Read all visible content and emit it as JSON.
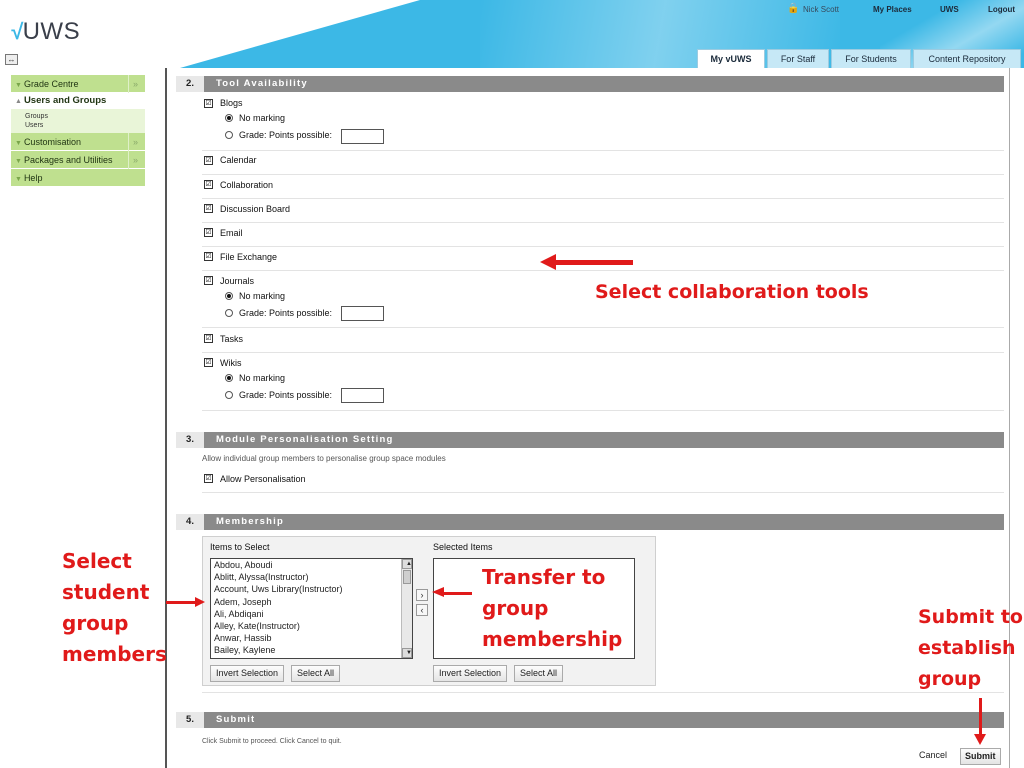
{
  "header": {
    "logo": "UWS",
    "user_name": "Nick Scott",
    "links": [
      "My Places",
      "UWS",
      "Logout"
    ],
    "tabs": [
      "My vUWS",
      "For Staff",
      "For Students",
      "Content Repository"
    ],
    "active_tab": "My vUWS",
    "brand_color": "#3cb8e6"
  },
  "sidebar": {
    "items": [
      {
        "label": "Grade Centre"
      },
      {
        "label": "Users and Groups",
        "open": true,
        "sub": [
          "Groups",
          "Users"
        ]
      },
      {
        "label": "Customisation"
      },
      {
        "label": "Packages and Utilities"
      },
      {
        "label": "Help"
      }
    ],
    "accent_color": "#bfe08f"
  },
  "section2": {
    "num": "2.",
    "title": "Tool Availability",
    "tools": [
      "Blogs",
      "Calendar",
      "Collaboration",
      "Discussion Board",
      "Email",
      "File Exchange",
      "Journals",
      "Tasks",
      "Wikis"
    ],
    "grading_options": {
      "no_marking": "No marking",
      "grade": "Grade: Points possible:"
    }
  },
  "section3": {
    "num": "3.",
    "title": "Module Personalisation Setting",
    "description": "Allow individual group members to personalise group space modules",
    "checkbox_label": "Allow Personalisation"
  },
  "section4": {
    "num": "4.",
    "title": "Membership",
    "items_label": "Items to Select",
    "selected_label": "Selected Items",
    "items": [
      "Abdou, Aboudi",
      "Ablitt, Alyssa(Instructor)",
      "Account, Uws Library(Instructor)",
      "Adem, Joseph",
      "Ali, Abdiqani",
      "Alley, Kate(Instructor)",
      "Anwar, Hassib",
      "Bailey, Kaylene"
    ],
    "invert_label": "Invert Selection",
    "select_all_label": "Select All",
    "move_right": "›",
    "move_left": "‹"
  },
  "section5": {
    "num": "5.",
    "title": "Submit",
    "instructions": "Click Submit to proceed. Click Cancel to quit.",
    "cancel_label": "Cancel",
    "submit_label": "Submit"
  },
  "annotations": {
    "tools": "Select collaboration tools",
    "members": [
      "Select",
      "student",
      "group",
      "members"
    ],
    "transfer": [
      "Transfer to",
      "group",
      "membership"
    ],
    "submit": [
      "Submit to",
      "establish",
      "group"
    ],
    "color": "#e01a1a"
  }
}
